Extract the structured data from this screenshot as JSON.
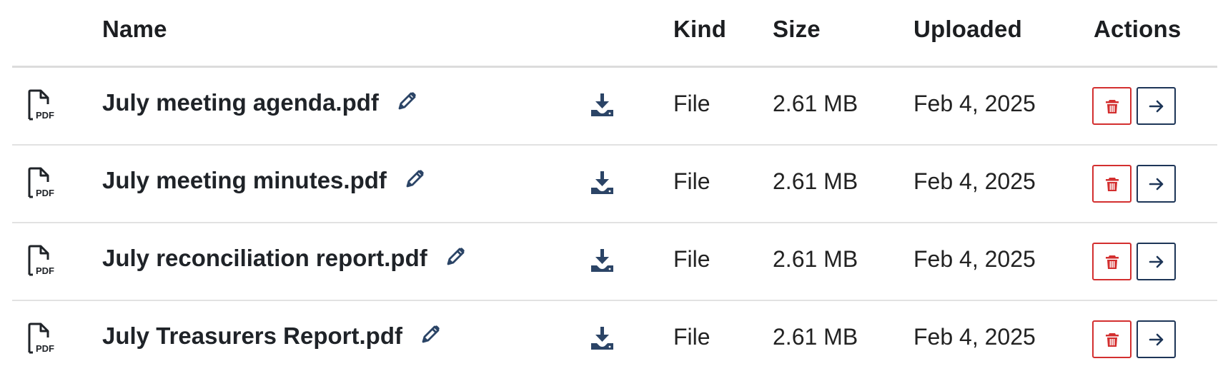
{
  "colors": {
    "text": "#1f2328",
    "icon_navy": "#2b4466",
    "danger": "#d32f2f",
    "primary_border": "#1d3557",
    "divider": "#e2e2e2"
  },
  "table": {
    "columns": {
      "name": "Name",
      "kind": "Kind",
      "size": "Size",
      "uploaded": "Uploaded",
      "actions": "Actions"
    },
    "rows": [
      {
        "icon": "pdf-file-icon",
        "name": "July meeting agenda.pdf",
        "kind": "File",
        "size": "2.61 MB",
        "uploaded": "Feb 4, 2025"
      },
      {
        "icon": "pdf-file-icon",
        "name": "July meeting minutes.pdf",
        "kind": "File",
        "size": "2.61 MB",
        "uploaded": "Feb 4, 2025"
      },
      {
        "icon": "pdf-file-icon",
        "name": "July reconciliation report.pdf",
        "kind": "File",
        "size": "2.61 MB",
        "uploaded": "Feb 4, 2025"
      },
      {
        "icon": "pdf-file-icon",
        "name": "July Treasurers Report.pdf",
        "kind": "File",
        "size": "2.61 MB",
        "uploaded": "Feb 4, 2025"
      }
    ],
    "row_icons": {
      "edit": "pencil-icon",
      "download": "download-icon",
      "delete": "trash-icon",
      "open": "arrow-right-icon"
    }
  }
}
